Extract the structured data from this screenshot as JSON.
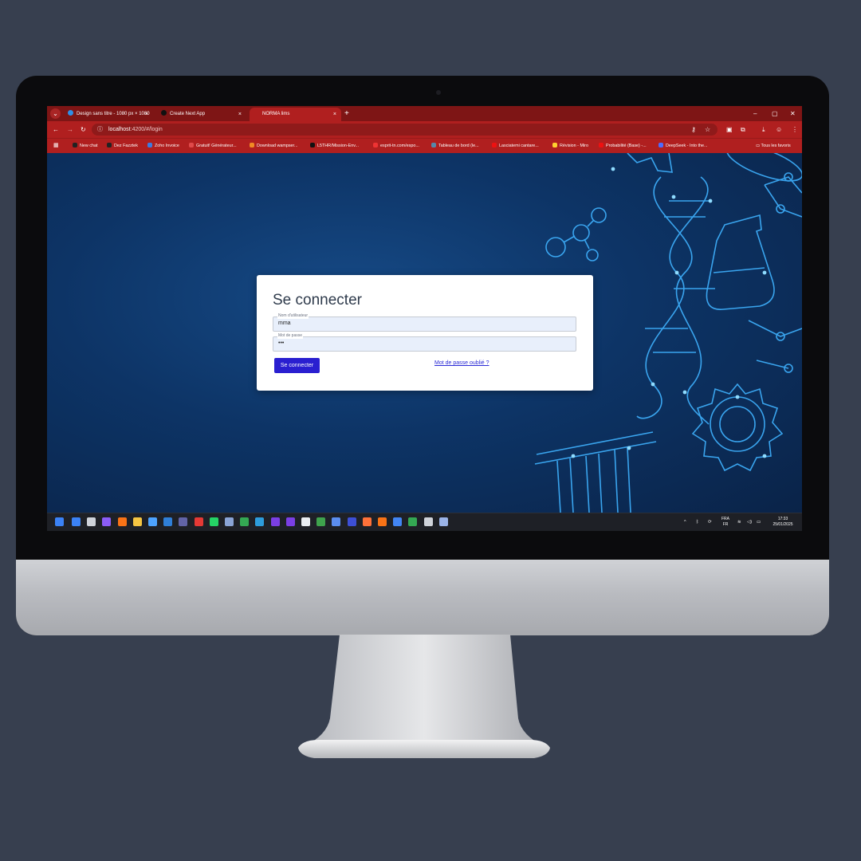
{
  "browser": {
    "tabs": [
      {
        "label": "Design sans titre - 1080 px × 1080",
        "close": "×",
        "favicon_color": "#2f8fe6"
      },
      {
        "label": "Create Next App",
        "close": "×",
        "favicon_color": "#111111"
      },
      {
        "label": "NORMA lims",
        "close": "×",
        "favicon_color": ""
      }
    ],
    "new_tab": "+",
    "window_controls": [
      "–",
      "▢",
      "✕"
    ],
    "url_host": "localhost",
    "url_path": ":4200/#/login",
    "bookmarks": [
      {
        "label": "New chat",
        "color": "#222"
      },
      {
        "label": "Dez Fazztek",
        "color": "#222"
      },
      {
        "label": "Zoho Invoice",
        "color": "#3d7be0"
      },
      {
        "label": "Gratuit! Générateur...",
        "color": "#e04a4a"
      },
      {
        "label": "Download wampser...",
        "color": "#f08a24"
      },
      {
        "label": "L5THR/Mission-Env...",
        "color": "#111"
      },
      {
        "label": "esprit-tn.com/espo...",
        "color": "#e33"
      },
      {
        "label": "Tableau de bord (le...",
        "color": "#58a"
      },
      {
        "label": "Lasciatemi cantare...",
        "color": "#e11"
      },
      {
        "label": "Révision - Miro",
        "color": "#ffd02f"
      },
      {
        "label": "Probabilité (Base) -...",
        "color": "#e11"
      },
      {
        "label": "DeepSeek - Into the...",
        "color": "#4d6bfe"
      }
    ],
    "all_bookmarks": "Tous les favoris"
  },
  "login": {
    "title": "Se connecter",
    "username_label": "Nom d'utilisateur",
    "username_value": "mma",
    "password_label": "Mot de passe",
    "password_value": "•••",
    "submit_label": "Se connecter",
    "forgot_label": "Mot de passe oublié ?"
  },
  "taskbar": {
    "icon_colors": [
      "#3b82f6",
      "#cfd3da",
      "#8b5cf6",
      "#f97316",
      "#f5c542",
      "#4da3ff",
      "#2f7fd8",
      "#6264a7",
      "#e53935",
      "#25d366",
      "#8aa4d6",
      "#34a853",
      "#2d9cdb",
      "#7b3fe4",
      "#7b3fe4",
      "#e9edf2",
      "#3fa34d",
      "#5b8def",
      "#3d4fd6",
      "#ff7139",
      "#f97316",
      "#4285f4",
      "#34a853",
      "#cfd3da",
      "#9ab3e8"
    ],
    "language": "FRA",
    "language_sub": "FR",
    "time": "17:33",
    "date": "25/01/2025"
  }
}
